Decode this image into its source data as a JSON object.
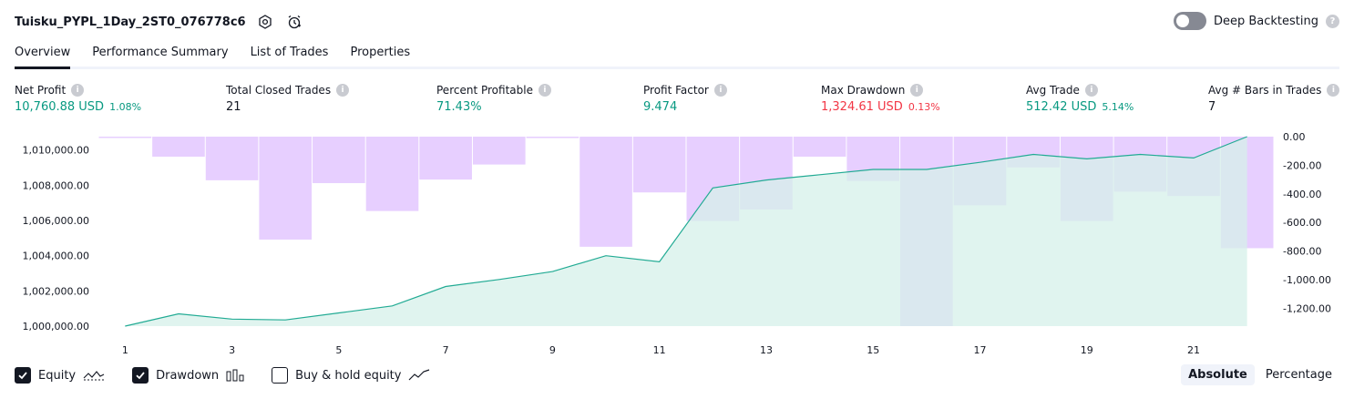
{
  "header": {
    "title": "Tuisku_PYPL_1Day_2ST0_076778c6",
    "deep_backtesting_label": "Deep Backtesting",
    "help_glyph": "?"
  },
  "tabs": [
    {
      "label": "Overview",
      "active": true
    },
    {
      "label": "Performance Summary",
      "active": false
    },
    {
      "label": "List of Trades",
      "active": false
    },
    {
      "label": "Properties",
      "active": false
    }
  ],
  "metrics": {
    "info_glyph": "i",
    "net_profit": {
      "label": "Net Profit",
      "value": "10,760.88 USD",
      "pct": "1.08%"
    },
    "total_closed_trades": {
      "label": "Total Closed Trades",
      "value": "21"
    },
    "percent_profitable": {
      "label": "Percent Profitable",
      "value": "71.43%"
    },
    "profit_factor": {
      "label": "Profit Factor",
      "value": "9.474"
    },
    "max_drawdown": {
      "label": "Max Drawdown",
      "value": "1,324.61 USD",
      "pct": "0.13%"
    },
    "avg_trade": {
      "label": "Avg Trade",
      "value": "512.42 USD",
      "pct": "5.14%"
    },
    "avg_bars": {
      "label": "Avg # Bars in Trades",
      "value": "7"
    }
  },
  "colors": {
    "equity_line": "#22ab94",
    "equity_fill": "#d5f0ea",
    "drawdown_bar": "#e1c3ff",
    "positive": "#089981",
    "negative": "#f23645"
  },
  "legend": {
    "equity": {
      "label": "Equity",
      "checked": true,
      "icon": "equity-line-icon"
    },
    "drawdown": {
      "label": "Drawdown",
      "checked": true,
      "icon": "drawdown-bars-icon"
    },
    "buy_hold": {
      "label": "Buy & hold equity",
      "checked": false,
      "icon": "buy-hold-line-icon"
    }
  },
  "mode": {
    "absolute": "Absolute",
    "percentage": "Percentage",
    "active": "absolute"
  },
  "chart_data": {
    "type": "line",
    "title": "",
    "x": [
      1,
      2,
      3,
      4,
      5,
      6,
      7,
      8,
      9,
      10,
      11,
      12,
      13,
      14,
      15,
      16,
      17,
      18,
      19,
      20,
      21,
      22
    ],
    "x_ticks": [
      "1",
      "3",
      "5",
      "7",
      "9",
      "11",
      "13",
      "15",
      "17",
      "19",
      "21"
    ],
    "series": [
      {
        "name": "Equity",
        "axis": "left",
        "style": "area",
        "values": [
          1000000,
          1000700,
          1000400,
          1000350,
          1000750,
          1001150,
          1002250,
          1002650,
          1003100,
          1004000,
          1003650,
          1007850,
          1008300,
          1008600,
          1008900,
          1008900,
          1009300,
          1009750,
          1009500,
          1009750,
          1009550,
          1010760
        ]
      },
      {
        "name": "Drawdown",
        "axis": "right",
        "style": "bar",
        "values": [
          -6,
          -140,
          -305,
          -720,
          -325,
          -520,
          -300,
          -195,
          -10,
          -770,
          -390,
          -590,
          -510,
          -140,
          -310,
          -1325,
          -480,
          -215,
          -590,
          -385,
          -415,
          -780
        ]
      }
    ],
    "y_left": {
      "min": 1000000,
      "max": 1010760,
      "ticks": [
        "1,000,000.00",
        "1,002,000.00",
        "1,004,000.00",
        "1,006,000.00",
        "1,008,000.00",
        "1,010,000.00"
      ],
      "tick_values": [
        1000000,
        1002000,
        1004000,
        1006000,
        1008000,
        1010000
      ]
    },
    "y_right": {
      "min": -1325,
      "max": 0,
      "ticks": [
        "0.00",
        "-200.00",
        "-400.00",
        "-600.00",
        "-800.00",
        "-1,000.00",
        "-1,200.00"
      ],
      "tick_values": [
        0,
        -200,
        -400,
        -600,
        -800,
        -1000,
        -1200
      ]
    },
    "grid": false,
    "legend": "bottom-left"
  }
}
